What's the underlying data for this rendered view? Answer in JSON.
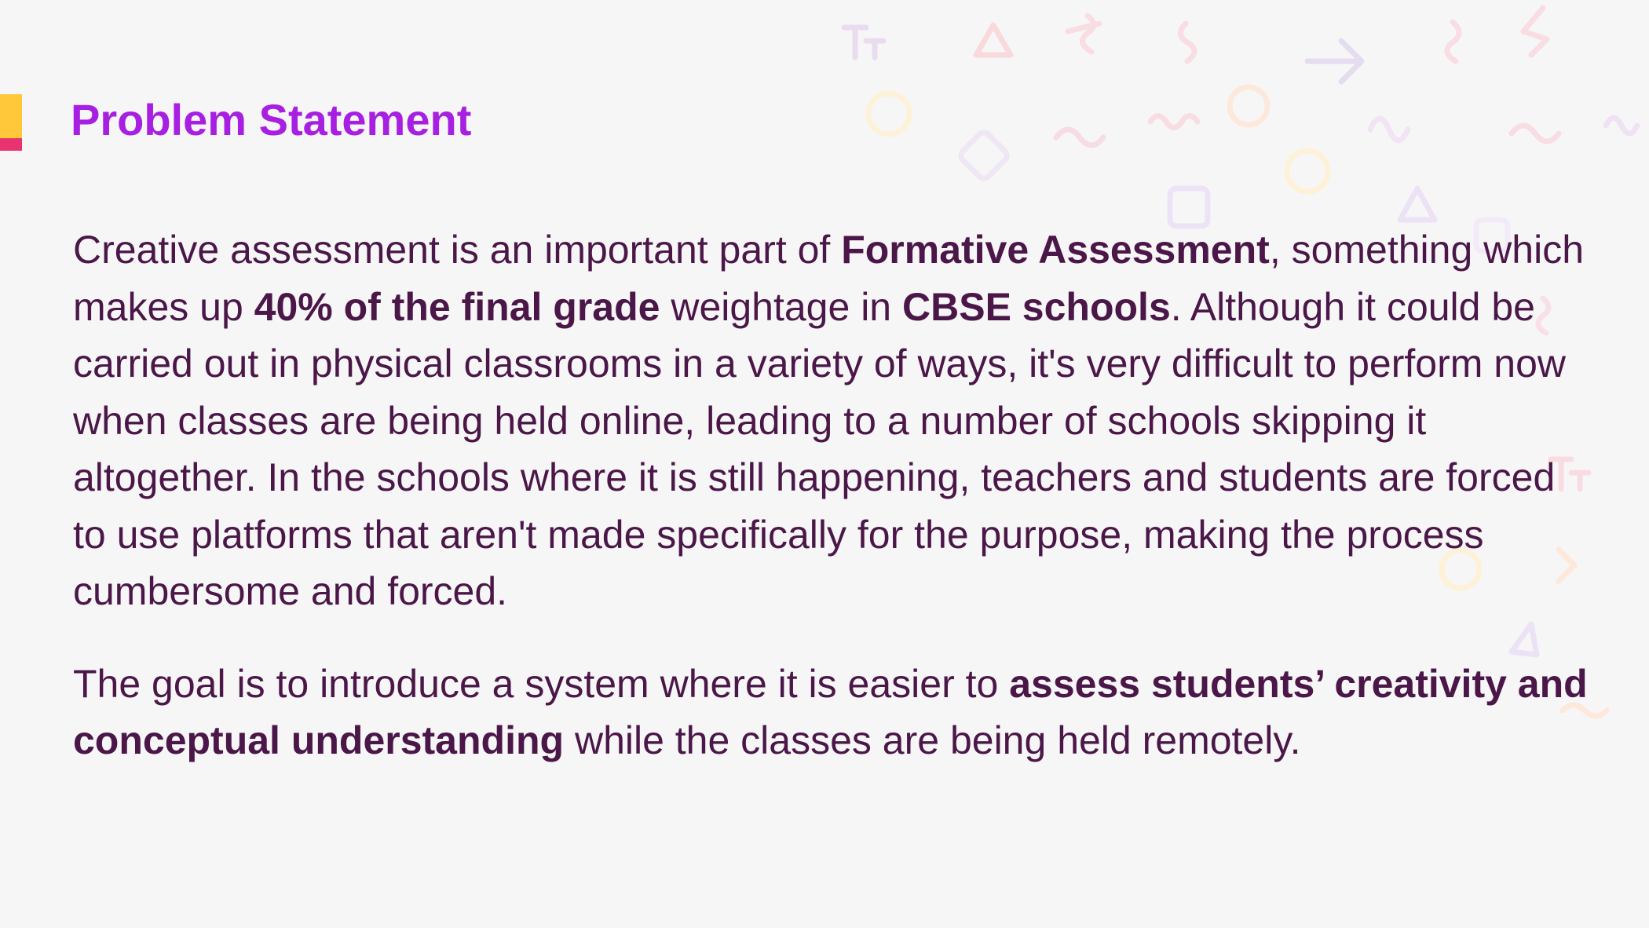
{
  "slide": {
    "title": "Problem Statement",
    "paragraph1": {
      "t1": "Creative assessment is an important part of ",
      "b1": "Formative Assessment",
      "t2": ", something which makes up ",
      "b2": "40% of the final grade",
      "t3": " weightage in ",
      "b3": "CBSE schools",
      "t4": ". Although it could be carried out in physical classrooms in a variety of ways, it's very difficult to perform now when classes are being held online, leading to a number of schools skipping it altogether. In the schools where it is still happening, teachers and students are forced to use platforms that aren't made specifically for the purpose, making the process cumbersome and forced."
    },
    "paragraph2": {
      "t1": "The goal is to introduce a system where it is easier to ",
      "b1": "assess students’ creativity and conceptual understanding",
      "t2": " while the classes are being held remotely."
    }
  },
  "colors": {
    "title": "#a71fe0",
    "body_text": "#4a1748",
    "accent_yellow": "#ffc83a",
    "accent_pink": "#e8336e",
    "background": "#f7f6f7"
  },
  "decorations": {
    "pattern_icons": [
      "text-size-icon",
      "triangle-icon",
      "circle-icon",
      "square-icon",
      "arrow-icon",
      "squiggle-icon"
    ]
  }
}
